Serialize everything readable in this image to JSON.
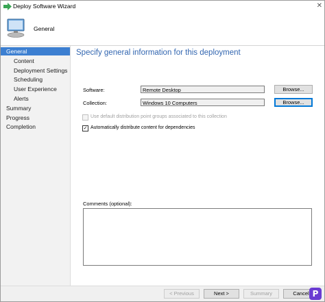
{
  "window": {
    "title": "Deploy Software Wizard"
  },
  "header": {
    "title": "General",
    "icon": "computer-icon"
  },
  "sidebar": {
    "items": [
      {
        "label": "General",
        "level": 1,
        "active": true
      },
      {
        "label": "Content",
        "level": 2,
        "active": false
      },
      {
        "label": "Deployment Settings",
        "level": 2,
        "active": false
      },
      {
        "label": "Scheduling",
        "level": 2,
        "active": false
      },
      {
        "label": "User Experience",
        "level": 2,
        "active": false
      },
      {
        "label": "Alerts",
        "level": 2,
        "active": false
      },
      {
        "label": "Summary",
        "level": 1,
        "active": false
      },
      {
        "label": "Progress",
        "level": 1,
        "active": false
      },
      {
        "label": "Completion",
        "level": 1,
        "active": false
      }
    ]
  },
  "main": {
    "heading": "Specify general information for this deployment",
    "software": {
      "label": "Software:",
      "value": "Remote Desktop",
      "browse": "Browse..."
    },
    "collection": {
      "label": "Collection:",
      "value": "Windows 10 Computers",
      "browse": "Browse..."
    },
    "use_default_groups": {
      "label": "Use default distribution point groups associated to this collection",
      "checked": false,
      "disabled": true
    },
    "auto_distribute": {
      "label": "Automatically distribute content for dependencies",
      "checked": true,
      "disabled": false
    },
    "comments": {
      "label": "Comments (optional):",
      "value": ""
    }
  },
  "footer": {
    "previous": "< Previous",
    "next": "Next >",
    "summary": "Summary",
    "cancel": "Cancel"
  },
  "colors": {
    "accent": "#3c7fd1",
    "heading": "#3266b0",
    "logo": "#6a3bd2"
  }
}
